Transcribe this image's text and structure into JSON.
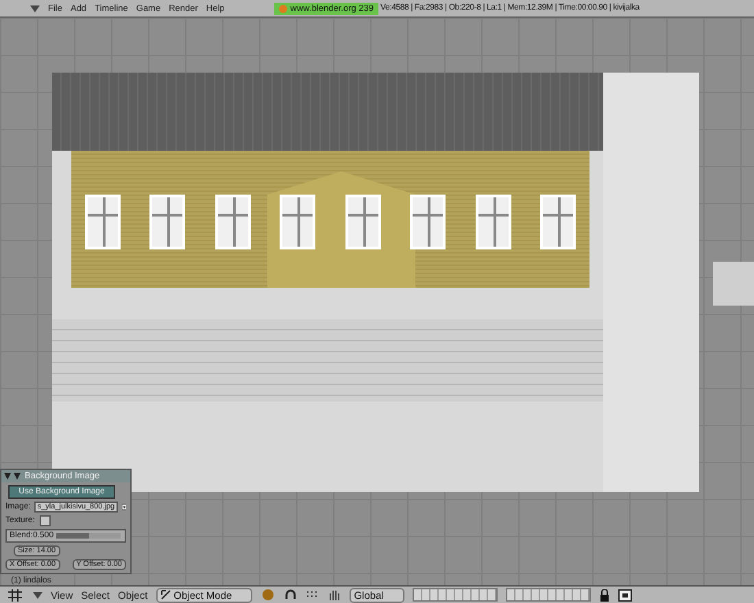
{
  "top_bar": {
    "menus": [
      "File",
      "Add",
      "Timeline",
      "Game",
      "Render",
      "Help"
    ],
    "site_badge": "www.blender.org 239",
    "stats": "Ve:4588 | Fa:2983 | Ob:220-8 | La:1 | Mem:12.39M | Time:00:00.90 | kivijalka"
  },
  "background_panel": {
    "title": "Background Image",
    "use_button": "Use Background Image",
    "image_label": "Image:",
    "image_value": "s_yla_julkisivu_800.jpg",
    "texture_label": "Texture:",
    "texture_checked": false,
    "blend": {
      "label": "Blend:0.500",
      "level": 0.5
    },
    "size": "Size: 14.00",
    "x_offset": "X Offset: 0.00",
    "y_offset": "Y Offset: 0.00"
  },
  "object_label": "(1) lindalos",
  "bottom_bar": {
    "menus": [
      "View",
      "Select",
      "Object"
    ],
    "mode": "Object Mode",
    "orientation": "Global"
  }
}
